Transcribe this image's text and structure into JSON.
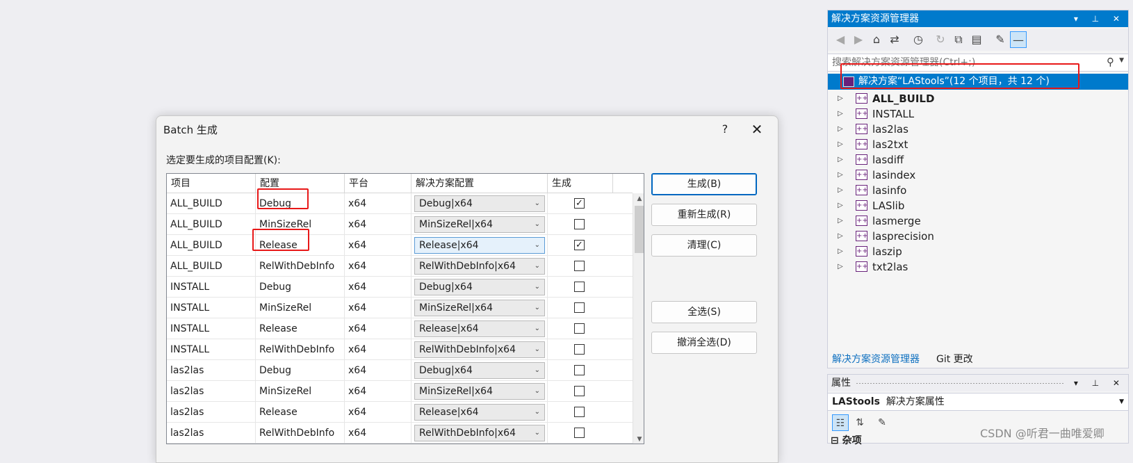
{
  "dialog": {
    "title": "Batch 生成",
    "help": "?",
    "close": "✕",
    "prompt": "选定要生成的项目配置(K):",
    "columns": [
      "项目",
      "配置",
      "平台",
      "解决方案配置",
      "生成"
    ],
    "rows": [
      {
        "project": "ALL_BUILD",
        "config": "Debug",
        "platform": "x64",
        "solution_config": "Debug|x64",
        "build": "✓"
      },
      {
        "project": "ALL_BUILD",
        "config": "MinSizeRel",
        "platform": "x64",
        "solution_config": "MinSizeRel|x64",
        "build": ""
      },
      {
        "project": "ALL_BUILD",
        "config": "Release",
        "platform": "x64",
        "solution_config": "Release|x64",
        "build": "✓"
      },
      {
        "project": "ALL_BUILD",
        "config": "RelWithDebInfo",
        "platform": "x64",
        "solution_config": "RelWithDebInfo|x64",
        "build": ""
      },
      {
        "project": "INSTALL",
        "config": "Debug",
        "platform": "x64",
        "solution_config": "Debug|x64",
        "build": ""
      },
      {
        "project": "INSTALL",
        "config": "MinSizeRel",
        "platform": "x64",
        "solution_config": "MinSizeRel|x64",
        "build": ""
      },
      {
        "project": "INSTALL",
        "config": "Release",
        "platform": "x64",
        "solution_config": "Release|x64",
        "build": ""
      },
      {
        "project": "INSTALL",
        "config": "RelWithDebInfo",
        "platform": "x64",
        "solution_config": "RelWithDebInfo|x64",
        "build": ""
      },
      {
        "project": "las2las",
        "config": "Debug",
        "platform": "x64",
        "solution_config": "Debug|x64",
        "build": ""
      },
      {
        "project": "las2las",
        "config": "MinSizeRel",
        "platform": "x64",
        "solution_config": "MinSizeRel|x64",
        "build": ""
      },
      {
        "project": "las2las",
        "config": "Release",
        "platform": "x64",
        "solution_config": "Release|x64",
        "build": ""
      },
      {
        "project": "las2las",
        "config": "RelWithDebInfo",
        "platform": "x64",
        "solution_config": "RelWithDebInfo|x64",
        "build": ""
      }
    ],
    "buttons": {
      "build": "生成(B)",
      "rebuild": "重新生成(R)",
      "clean": "清理(C)",
      "select_all": "全选(S)",
      "deselect_all": "撤消全选(D)"
    }
  },
  "solution_explorer": {
    "title": "解决方案资源管理器",
    "title_buttons": "▾ ⊥ ✕",
    "search_placeholder": "搜索解决方案资源管理器(Ctrl+;)",
    "solution_label": "解决方案“LAStools”(12 个项目，共 12 个)",
    "projects": [
      "ALL_BUILD",
      "INSTALL",
      "las2las",
      "las2txt",
      "lasdiff",
      "lasindex",
      "lasinfo",
      "LASlib",
      "lasmerge",
      "lasprecision",
      "laszip",
      "txt2las"
    ],
    "tabs": [
      "解决方案资源管理器",
      "Git 更改"
    ],
    "accent": "#007acc"
  },
  "properties": {
    "title": "属性",
    "title_buttons": "▾ ⊥ ✕",
    "object_name": "LAStools",
    "object_type": "解决方案属性",
    "category": "⊟ 杂项"
  },
  "watermark": "CSDN @听君一曲唯爱卿"
}
